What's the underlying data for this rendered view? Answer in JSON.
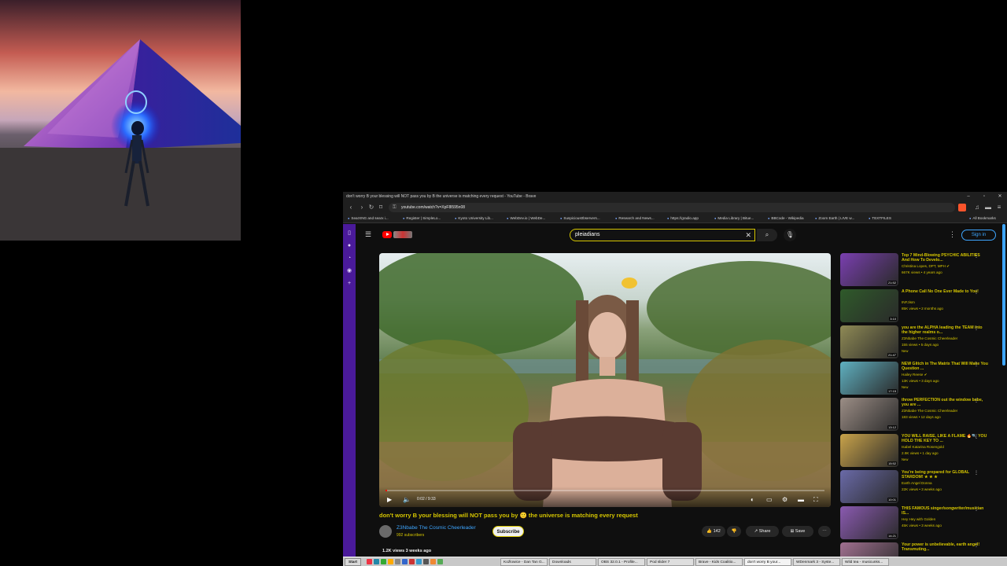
{
  "browser": {
    "window_title": "don't worry B your blessing will NOT pass you by B the universe is matching every request - YouTube - Brave",
    "url": "youtube.com/watch?v=XpF8l595n08",
    "bookmarks": [
      "SearXNG and searx i...",
      "Register | SimpleLo...",
      "Kyoto University Lib...",
      "WebDev.io | WebDe...",
      "Suspicious0bservers...",
      "Research and News...",
      "https://gradio.app",
      "Media Library | Bitue...",
      "BBCode - Wikipedia",
      "Zoom Earth | LIVE w...",
      "TEXTFILES"
    ],
    "all_bookmarks": "All Bookmarks"
  },
  "youtube": {
    "search_query": "pleiadians",
    "sign_in": "Sign in",
    "player": {
      "time": "0:02 / 9:33",
      "progress": 0.004
    },
    "video_title": "don't worry B your blessing will NOT pass you by 🙂 the universe is matching every request",
    "channel_name": "Z3Nbabe The Cosmic Cheerleader",
    "subscribers": "992 subscribers",
    "subscribe_label": "Subscribe",
    "likes": "142",
    "share_label": "Share",
    "save_label": "Save",
    "views_line": "1.2K views  3 weeks ago"
  },
  "recommendations": [
    {
      "title": "Top 7 Mind-Blowing PSYCHIC ABILITIES And How To Develo...",
      "channel": "Christina Lopes, DPT, MPH ✔",
      "meta": "667K views • 4 years ago",
      "badge": "",
      "duration": "21:52"
    },
    {
      "title": "A Phone Call No One Ever Made to You!",
      "channel": "INFJism",
      "meta": "85K views • 2 months ago",
      "badge": "",
      "duration": "3:10"
    },
    {
      "title": "you are the ALPHA leading the TEAM into the higher realms o...",
      "channel": "Z3Nbabe The Cosmic Cheerleader",
      "meta": "155 views • 5 days ago",
      "badge": "New",
      "duration": "21:47"
    },
    {
      "title": "NEW Glitch in The Matrix That Will Make You Question ...",
      "channel": "Hailey Reese ✔",
      "meta": "13K views • 3 days ago",
      "badge": "New",
      "duration": "17:15"
    },
    {
      "title": "throw PERFECTION out the window babe, you are ...",
      "channel": "Z3Nbabe The Cosmic Cheerleader",
      "meta": "183 views • 12 days ago",
      "badge": "",
      "duration": "13:12"
    },
    {
      "title": "YOU WILL RAISE, LIKE A FLAME 🔥🔍 YOU HOLD THE KEY TO ...",
      "channel": "Isabel Katarina Rosengold",
      "meta": "2.9K views • 1 day ago",
      "badge": "New",
      "duration": "15:52"
    },
    {
      "title": "You're being prepared for GLOBAL STARDOM! ★ ★ ★",
      "channel": "Earth Angel Donna",
      "meta": "22K views • 3 weeks ago",
      "badge": "",
      "duration": "10:01"
    },
    {
      "title": "THIS FAMOUS singer/songwriter/musician IS...",
      "channel": "Hey Hey with Golden",
      "meta": "45K views • 3 weeks ago",
      "badge": "",
      "duration": "14:21"
    },
    {
      "title": "Your power is unbelievable, earth angel! Transmuting...",
      "channel": "",
      "meta": "",
      "badge": "",
      "duration": ""
    }
  ],
  "taskbar": {
    "start": "Start",
    "items": [
      "Koźlowice - Dan Tan G...",
      "Downloads",
      "OBS 32.0.1 - Profile...",
      "Pod slider 7",
      "Brave - Kids Coalitio...",
      "don't worry B your...",
      "WDenmark 3 - Syste...",
      "Wild tea - musicunks..."
    ]
  },
  "colors": {
    "accent_yellow": "#d6c600",
    "link_blue": "#3ea6ff",
    "youtube_red": "#ff0000",
    "rail_purple": "#4a1a9a"
  }
}
